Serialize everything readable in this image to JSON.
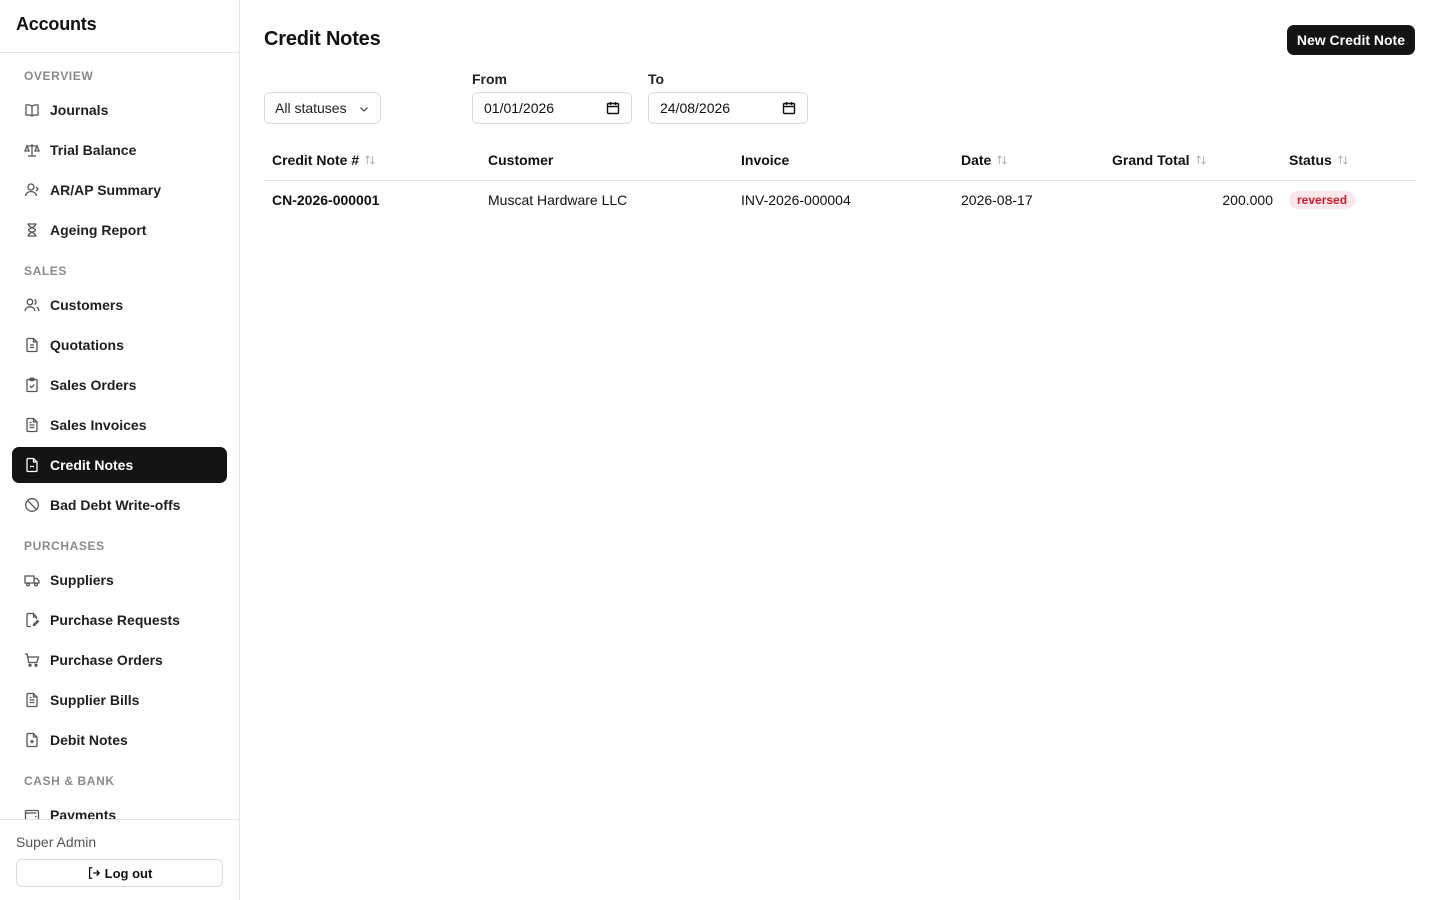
{
  "app": {
    "title": "Accounts"
  },
  "sidebar": {
    "sections": [
      {
        "label": "OVERVIEW",
        "items": [
          {
            "label": "Journals",
            "icon": "book-icon"
          },
          {
            "label": "Trial Balance",
            "icon": "scale-icon"
          },
          {
            "label": "AR/AP Summary",
            "icon": "user-icon"
          },
          {
            "label": "Ageing Report",
            "icon": "hourglass-icon"
          }
        ]
      },
      {
        "label": "SALES",
        "items": [
          {
            "label": "Customers",
            "icon": "users-icon"
          },
          {
            "label": "Quotations",
            "icon": "document-list-icon"
          },
          {
            "label": "Sales Orders",
            "icon": "clipboard-check-icon"
          },
          {
            "label": "Sales Invoices",
            "icon": "file-text-icon"
          },
          {
            "label": "Credit Notes",
            "icon": "file-minus-icon",
            "active": true
          },
          {
            "label": "Bad Debt Write-offs",
            "icon": "ban-icon"
          }
        ]
      },
      {
        "label": "PURCHASES",
        "items": [
          {
            "label": "Suppliers",
            "icon": "truck-icon"
          },
          {
            "label": "Purchase Requests",
            "icon": "file-edit-icon"
          },
          {
            "label": "Purchase Orders",
            "icon": "cart-icon"
          },
          {
            "label": "Supplier Bills",
            "icon": "file-text-icon"
          },
          {
            "label": "Debit Notes",
            "icon": "file-plus-icon"
          }
        ]
      },
      {
        "label": "CASH & BANK",
        "items": [
          {
            "label": "Payments",
            "icon": "wallet-icon"
          }
        ]
      }
    ],
    "footer": {
      "user": "Super Admin",
      "logout_label": "Log out"
    }
  },
  "page": {
    "title": "Credit Notes",
    "new_button": "New Credit Note",
    "filters": {
      "status_value": "All statuses",
      "from_label": "From",
      "from_value": "01/01/2026",
      "to_label": "To",
      "to_value": "24/08/2026"
    },
    "table": {
      "columns": [
        "Credit Note #",
        "Customer",
        "Invoice",
        "Date",
        "Grand Total",
        "Status"
      ],
      "rows": [
        {
          "credit_note": "CN-2026-000001",
          "customer": "Muscat Hardware LLC",
          "invoice": "INV-2026-000004",
          "date": "2026-08-17",
          "grand_total": "200.000",
          "status": "reversed"
        }
      ]
    }
  },
  "colors": {
    "accent": "#141414",
    "status_reversed_bg": "#fde7ea",
    "status_reversed_fg": "#d11a2a"
  }
}
